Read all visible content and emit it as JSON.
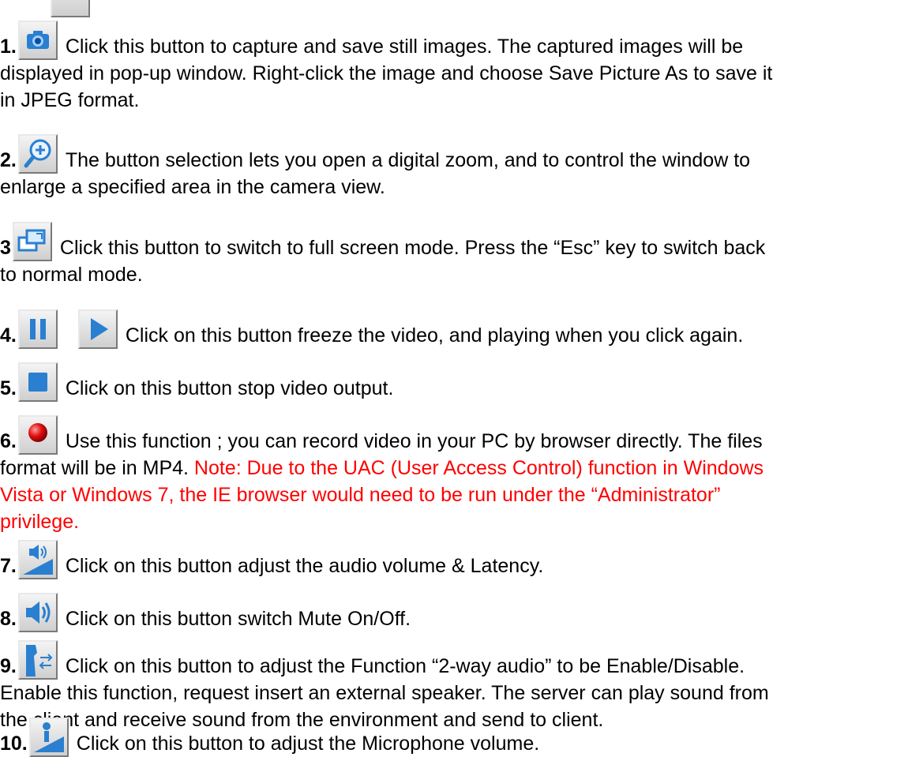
{
  "items": [
    {
      "num": "1.",
      "icon": "camera-icon",
      "line1": "Click this button to capture and save still images. The captured images will be",
      "line2": "displayed in pop-up window. Right-click the image and choose Save Picture As to save it",
      "line3": "in JPEG format."
    },
    {
      "num": "2.",
      "icon": "zoom-in-icon",
      "line1": "The button selection lets you open a digital zoom, and to control the window to",
      "line2": "enlarge a specified area in the camera view."
    },
    {
      "num": "3",
      "icon": "fullscreen-icon",
      "line1": "Click this button to switch to full screen mode. Press the “Esc” key to switch back",
      "line2": "to normal mode."
    },
    {
      "num": "4.",
      "icon": "pause-icon",
      "icon2": "play-icon",
      "line1": "Click on this button freeze the video, and playing when you click again."
    },
    {
      "num": "5.",
      "icon": "stop-icon",
      "line1": "Click on this button stop video output."
    },
    {
      "num": "6.",
      "icon": "record-icon",
      "line1": "Use this function ; you can record video in your PC by browser directly. The files",
      "line2a": "format will be in MP4. ",
      "line2b": "Note: Due to the UAC (User Access Control) function in Windows",
      "line3": "Vista or Windows 7, the IE browser would need to be run under the “Administrator”",
      "line4": "privilege."
    },
    {
      "num": "7.",
      "icon": "volume-adjust-icon",
      "line1": "Click on this button adjust the audio volume & Latency."
    },
    {
      "num": "8.",
      "icon": "speaker-icon",
      "line1": "Click on this button switch Mute On/Off."
    },
    {
      "num": "9.",
      "icon": "two-way-audio-icon",
      "line1": "Click on this button to adjust the Function “2-way audio” to be Enable/Disable.",
      "line2": "Enable this function, request insert an external speaker. The server can play sound from",
      "line3": "the client and receive sound from the environment and send to client."
    },
    {
      "num": "10.",
      "icon": "microphone-volume-icon",
      "line1": "Click on this button to adjust the Microphone volume."
    }
  ],
  "colors": {
    "text": "#000000",
    "note": "#ff0000",
    "icon_blue": "#2a7fd0"
  }
}
